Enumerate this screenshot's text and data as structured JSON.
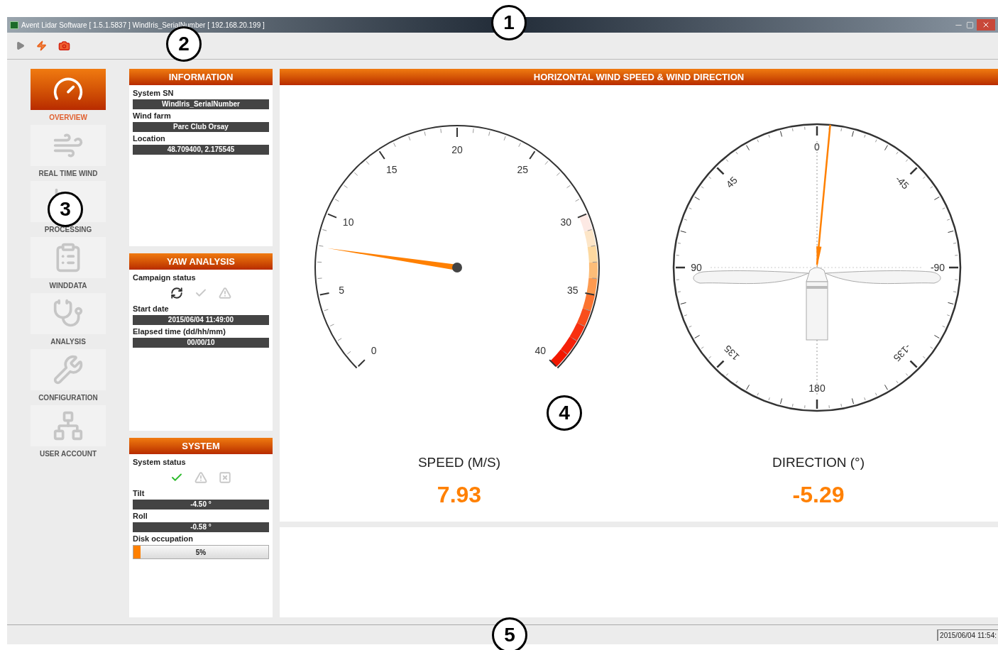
{
  "window": {
    "title": "Avent Lidar Software [ 1.5.1.5837 ] WindIris_SerialNumber [ 192.168.20.199 ]"
  },
  "nav": [
    {
      "label": "OVERVIEW",
      "kind": "overview",
      "selected": true
    },
    {
      "label": "REAL TIME WIND",
      "kind": "wind",
      "selected": false
    },
    {
      "label": "PROCESSING",
      "kind": "processing",
      "selected": false
    },
    {
      "label": "WINDDATA",
      "kind": "data",
      "selected": false
    },
    {
      "label": "ANALYSIS",
      "kind": "analysis",
      "selected": false
    },
    {
      "label": "CONFIGURATION",
      "kind": "configuration",
      "selected": false
    },
    {
      "label": "USER ACCOUNT",
      "kind": "account",
      "selected": false
    }
  ],
  "information": {
    "title": "INFORMATION",
    "fields": [
      {
        "label": "System SN",
        "value": "WindIris_SerialNumber"
      },
      {
        "label": "Wind farm",
        "value": "Parc Club Orsay"
      },
      {
        "label": "Location",
        "value": "48.709400, 2.175545"
      }
    ]
  },
  "yaw_analysis": {
    "title": "YAW ANALYSIS",
    "status_label": "Campaign status",
    "status_icons": [
      {
        "kind": "running",
        "active": true
      },
      {
        "kind": "ok",
        "active": false
      },
      {
        "kind": "warning",
        "active": false
      }
    ],
    "fields": [
      {
        "label": "Start date",
        "value": "2015/06/04 11:49:00"
      },
      {
        "label": "Elapsed time (dd/hh/mm)",
        "value": "00/00/10"
      }
    ]
  },
  "system": {
    "title": "SYSTEM",
    "status_label": "System status",
    "status_icons": [
      {
        "kind": "ok",
        "active": true
      },
      {
        "kind": "warning",
        "active": false
      },
      {
        "kind": "error",
        "active": false
      }
    ],
    "fields": [
      {
        "label": "Tilt",
        "value": "-4.50 °"
      },
      {
        "label": "Roll",
        "value": "-0.58 °"
      }
    ],
    "disk": {
      "label": "Disk occupation",
      "level": 0.05,
      "reading": "5%"
    }
  },
  "wind_panel": {
    "title": "HORIZONTAL WIND SPEED & WIND DIRECTION",
    "speed_gauge": {
      "tick_labels": [
        "0",
        "5",
        "10",
        "15",
        "20",
        "25",
        "30",
        "35",
        "40"
      ],
      "level": 0.198
    },
    "compass": {
      "labels": [
        "0",
        "-45",
        "-90",
        "-135",
        "180",
        "135",
        "90",
        "45"
      ]
    },
    "readouts": [
      {
        "label": "SPEED (M/S)",
        "value": "7.93"
      },
      {
        "label": "DIRECTION (°)",
        "value": "-5.29"
      }
    ]
  },
  "status_bar": {
    "datetime": "2015/06/04 11:54:"
  },
  "callouts": [
    "1",
    "2",
    "3",
    "4",
    "5"
  ]
}
